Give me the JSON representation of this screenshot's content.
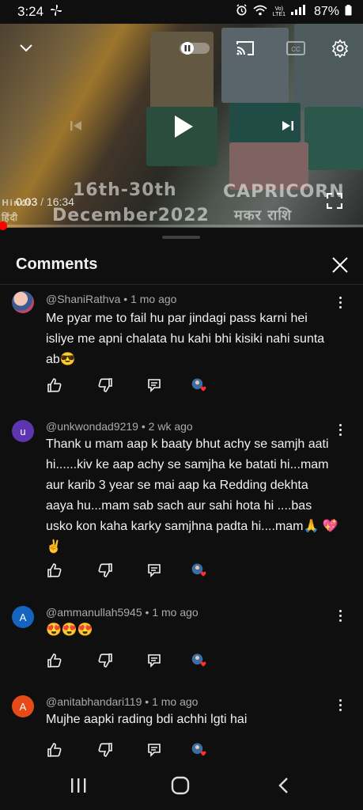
{
  "status_bar": {
    "time": "3:24",
    "battery": "87%",
    "icons": [
      "pinwheel-icon",
      "alarm-icon",
      "wifi-icon",
      "volte-icon",
      "signal-icon",
      "battery-icon"
    ]
  },
  "video": {
    "overlay_left_line1": "16th-30th",
    "overlay_left_line2": "December2022",
    "overlay_right_line1": "CAPRICORN",
    "overlay_right_line2": "मकर राशि",
    "overlay_lang": "Hindi",
    "overlay_lang2": "हिंदी",
    "current_time": "0:03",
    "duration": "16:34",
    "progress": 0.003,
    "icons": [
      "chevron-down-icon",
      "pause-toggle-icon",
      "cast-icon",
      "captions-icon",
      "settings-icon",
      "previous-icon",
      "play-icon",
      "next-icon",
      "fullscreen-icon"
    ]
  },
  "comments_panel": {
    "title": "Comments",
    "comments": [
      {
        "author": "@ShaniRathva",
        "age": "1 mo ago",
        "avatar_letter": "",
        "avatar_color": "#c1446f",
        "text": "Me pyar me to fail hu par jindagi pass karni hei isliye me apni chalata hu kahi bhi kisiki nahi sunta ab😎"
      },
      {
        "author": "@unkwondad9219",
        "age": "2 wk ago",
        "avatar_letter": "u",
        "avatar_color": "#5e35b1",
        "text": "Thank u mam aap k baaty bhut achy se samjh aati hi......kiv ke aap achy se samjha ke batati hi...mam aur karib 3 year se mai aap ka Redding dekhta aaya hu...mam sab sach aur sahi hota hi ....bas usko kon kaha karky samjhna padta hi....mam🙏 💖✌️"
      },
      {
        "author": "@ammanullah5945",
        "age": "1 mo ago",
        "avatar_letter": "A",
        "avatar_color": "#1565c0",
        "text": "😍😍😍"
      },
      {
        "author": "@anitabhandari119",
        "age": "1 mo ago",
        "avatar_letter": "A",
        "avatar_color": "#e64a19",
        "text": "Mujhe aapki rading bdi achhi lgti hai"
      }
    ]
  },
  "nav_bar": {
    "icons": [
      "recents-icon",
      "home-icon",
      "back-icon"
    ]
  }
}
